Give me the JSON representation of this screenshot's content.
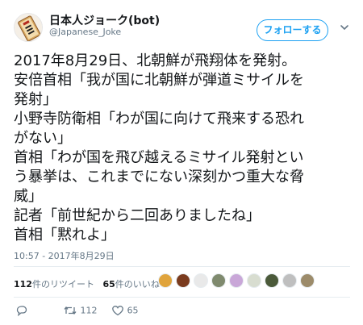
{
  "account": {
    "name": "日本人ジョーク(bot)",
    "handle": "@Japanese_Joke",
    "follow_label": "フォローする"
  },
  "tweet": {
    "lines": [
      "2017年8月29日、北朝鮮が飛翔体を発射。",
      "安倍首相「我が国に北朝鮮が弾道ミサイルを",
      "発射」",
      "小野寺防衛相「わが国に向けて飛来する恐れ",
      "がない」",
      "首相「わが国を飛び越えるミサイル発射とい",
      "う暴挙は、これまでにない深刻かつ重大な脅",
      "威」",
      "記者「前世紀から二回ありましたね」",
      "首相「黙れよ」"
    ],
    "timestamp": "10:57 - 2017年8月29日"
  },
  "stats": {
    "retweets_count": "112",
    "retweets_label": "件のリツイート",
    "likes_count": "65",
    "likes_label": "件のいいね"
  },
  "actions": {
    "retweet_count": "112",
    "like_count": "65"
  },
  "colors": {
    "accent": "#1da1f2",
    "secondary_text": "#657786",
    "divider": "#e6ecf0"
  },
  "icons": [
    "avatar-talisman",
    "chevron-down-icon",
    "reply-icon",
    "retweet-icon",
    "like-icon"
  ]
}
